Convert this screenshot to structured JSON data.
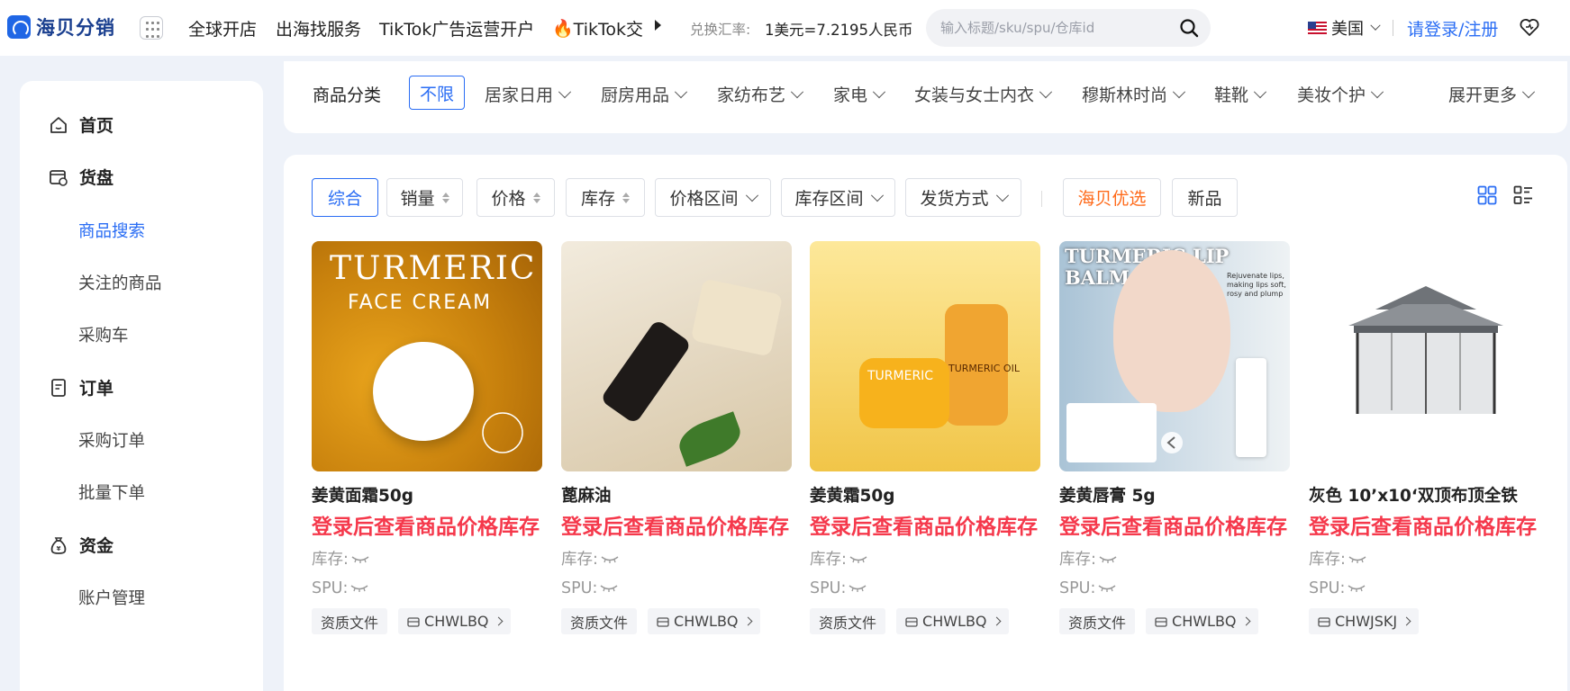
{
  "header": {
    "logo_text": "海贝分销",
    "nav": [
      "全球开店",
      "出海找服务",
      "TikTok广告运营开户",
      "TikTok交"
    ],
    "rate_label": "兑换汇率:",
    "rate_value": "1美元=7.2195人民币",
    "search_placeholder": "输入标题/sku/spu/仓库id",
    "region": "美国",
    "login_label": "请登录/注册"
  },
  "sidebar": {
    "groups": [
      {
        "label": "首页",
        "icon": "home-icon"
      },
      {
        "label": "货盘",
        "icon": "goods-icon",
        "items": [
          "商品搜索",
          "关注的商品",
          "采购车"
        ]
      },
      {
        "label": "订单",
        "icon": "order-icon",
        "items": [
          "采购订单",
          "批量下单"
        ]
      },
      {
        "label": "资金",
        "icon": "money-bag-icon",
        "items": [
          "账户管理"
        ]
      }
    ],
    "active_item": "商品搜索"
  },
  "categories": {
    "title": "商品分类",
    "selected": "不限",
    "items": [
      "居家日用",
      "厨房用品",
      "家纺布艺",
      "家电",
      "女装与女士内衣",
      "穆斯林时尚",
      "鞋靴",
      "美妆个护"
    ],
    "more_label": "展开更多"
  },
  "filters": {
    "items": [
      "综合",
      "销量",
      "价格",
      "库存",
      "价格区间",
      "库存区间",
      "发货方式"
    ],
    "highlight": "海贝优选",
    "new": "新品"
  },
  "products": [
    {
      "name": "姜黄面霜50g",
      "price_note": "登录后查看商品价格库存",
      "stock_label": "库存:",
      "spu_label": "SPU:",
      "doc_tag": "资质文件",
      "warehouse": "CHWLBQ",
      "art_line1": "TURMERIC",
      "art_line2": "FACE CREAM"
    },
    {
      "name": "蓖麻油",
      "price_note": "登录后查看商品价格库存",
      "stock_label": "库存:",
      "spu_label": "SPU:",
      "doc_tag": "资质文件",
      "warehouse": "CHWLBQ"
    },
    {
      "name": "姜黄霜50g",
      "price_note": "登录后查看商品价格库存",
      "stock_label": "库存:",
      "spu_label": "SPU:",
      "doc_tag": "资质文件",
      "warehouse": "CHWLBQ",
      "art_line1": "TURMERIC",
      "art_line2": "TURMERIC OIL"
    },
    {
      "name": "姜黄唇膏 5g",
      "price_note": "登录后查看商品价格库存",
      "stock_label": "库存:",
      "spu_label": "SPU:",
      "doc_tag": "资质文件",
      "warehouse": "CHWLBQ",
      "art_line1": "TURMERIC LIP",
      "art_line2": "BALM",
      "art_caption": "Rejuvenate lips, making lips soft, rosy and plump"
    },
    {
      "name": "灰色 10’x10‘双顶布顶全铁",
      "price_note": "登录后查看商品价格库存",
      "stock_label": "库存:",
      "spu_label": "SPU:",
      "warehouse": "CHWJSKJ"
    }
  ],
  "colors": {
    "accent": "#2a6df4",
    "price": "#f5384b",
    "highlight": "#ff6a1a",
    "background": "#eef2f9"
  }
}
